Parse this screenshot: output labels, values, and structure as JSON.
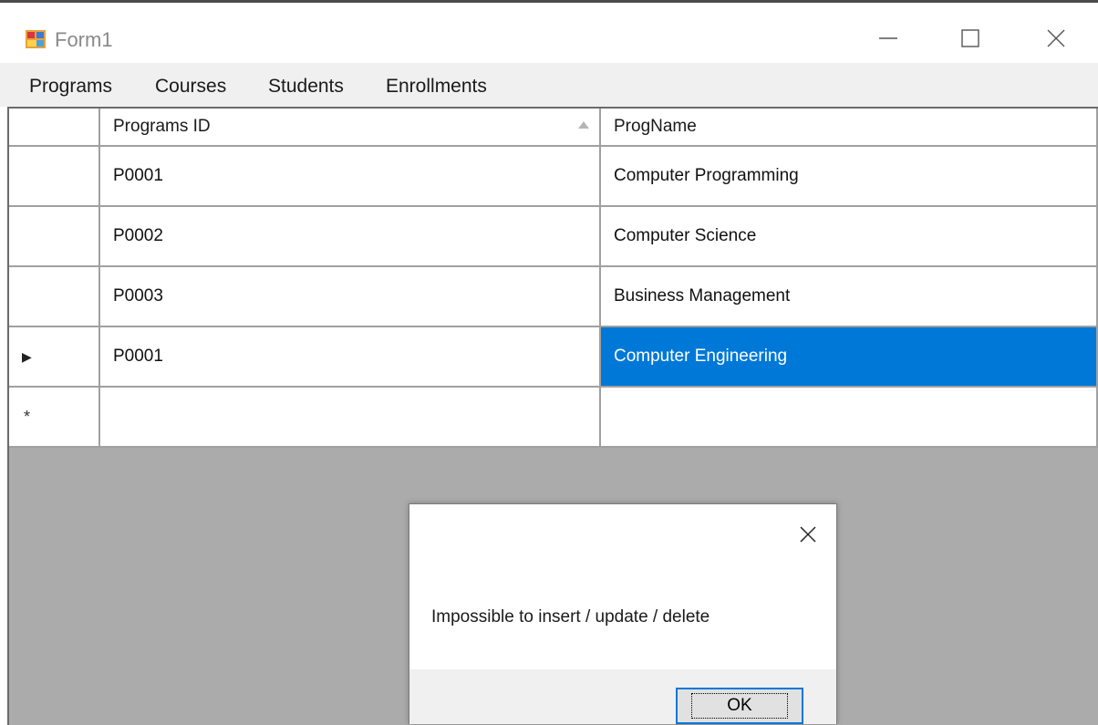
{
  "window": {
    "title": "Form1",
    "controls": [
      "minimize-icon",
      "maximize-icon",
      "close-icon"
    ]
  },
  "menu": {
    "items": [
      "Programs",
      "Courses",
      "Students",
      "Enrollments"
    ]
  },
  "grid": {
    "columns": [
      "Programs ID",
      "ProgName"
    ],
    "sorted_column": "Programs ID",
    "rows": [
      {
        "id": "P0001",
        "name": "Computer Programming"
      },
      {
        "id": "P0002",
        "name": "Computer Science"
      },
      {
        "id": "P0003",
        "name": "Business Management"
      },
      {
        "id": "P0001",
        "name": "Computer Engineering"
      }
    ],
    "current_row_marker": "▶",
    "new_row_marker": "*",
    "selection_color": "#0078d7"
  },
  "dialog": {
    "message": "Impossible to insert / update / delete",
    "ok_label": "OK"
  }
}
